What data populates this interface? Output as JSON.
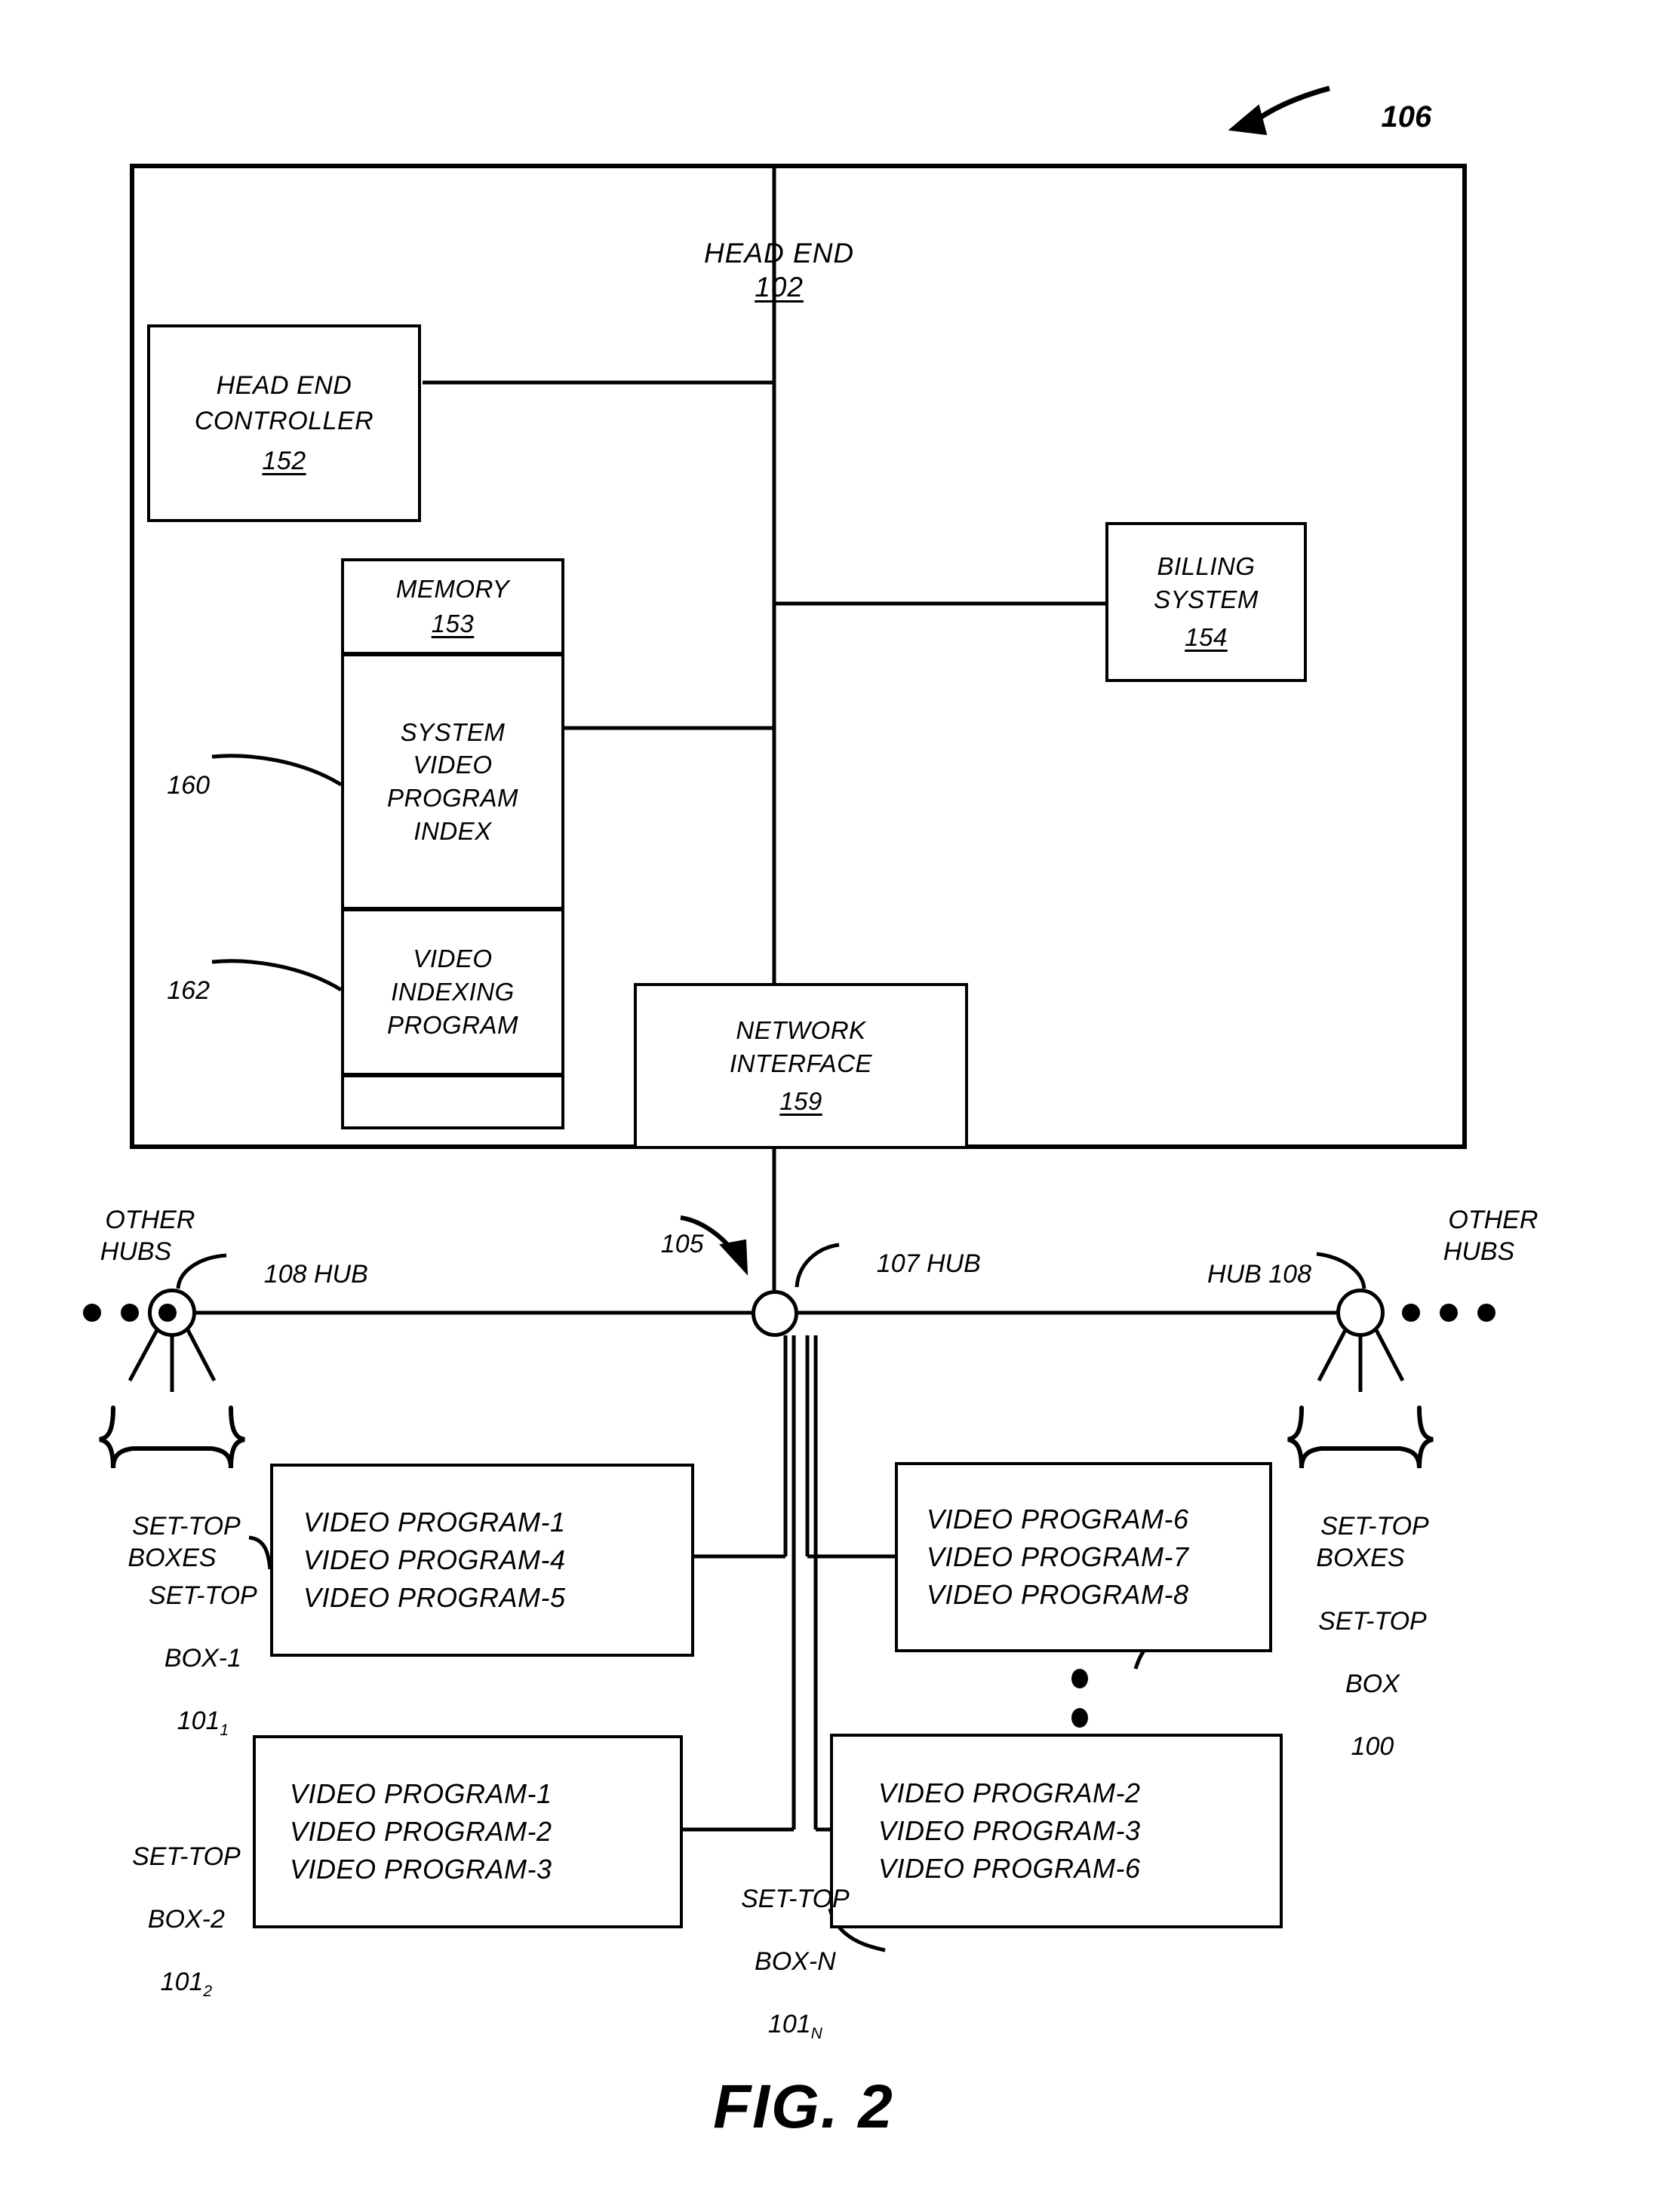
{
  "figure": {
    "caption": "FIG. 2",
    "system_ref": "106"
  },
  "head_end": {
    "title": "HEAD END",
    "title_ref": "102",
    "controller": {
      "line1": "HEAD END",
      "line2": "CONTROLLER",
      "ref": "152"
    },
    "memory": {
      "title": "MEMORY",
      "ref": "153",
      "sections": [
        {
          "ref": "160",
          "lines": [
            "SYSTEM",
            "VIDEO",
            "PROGRAM",
            "INDEX"
          ]
        },
        {
          "ref": "162",
          "lines": [
            "VIDEO",
            "INDEXING",
            "PROGRAM"
          ]
        },
        {
          "ref": "",
          "lines": []
        }
      ]
    },
    "billing": {
      "line1": "BILLING",
      "line2": "SYSTEM",
      "ref": "154"
    },
    "network_interface": {
      "line1": "NETWORK",
      "line2": "INTERFACE",
      "ref": "159"
    }
  },
  "network": {
    "bus_ref": "105",
    "hub_left": {
      "label": "108 HUB",
      "other_hubs": "OTHER\nHUBS",
      "set_top_boxes": "SET-TOP\nBOXES"
    },
    "hub_center": {
      "label": "107 HUB"
    },
    "hub_right": {
      "label": "HUB 108",
      "other_hubs": "OTHER\nHUBS",
      "set_top_boxes": "SET-TOP\nBOXES"
    }
  },
  "set_top_boxes": [
    {
      "caption_lines": [
        "SET-TOP",
        "BOX-1"
      ],
      "ref": "101",
      "ref_sub": "1",
      "programs": [
        "VIDEO PROGRAM-1",
        "VIDEO PROGRAM-4",
        "VIDEO PROGRAM-5"
      ]
    },
    {
      "caption_lines": [
        "SET-TOP",
        "BOX"
      ],
      "ref": "100",
      "ref_sub": "",
      "programs": [
        "VIDEO PROGRAM-6",
        "VIDEO PROGRAM-7",
        "VIDEO PROGRAM-8"
      ]
    },
    {
      "caption_lines": [
        "SET-TOP",
        "BOX-2"
      ],
      "ref": "101",
      "ref_sub": "2",
      "programs": [
        "VIDEO PROGRAM-1",
        "VIDEO PROGRAM-2",
        "VIDEO PROGRAM-3"
      ]
    },
    {
      "caption_lines": [
        "SET-TOP",
        "BOX-N"
      ],
      "ref": "101",
      "ref_sub": "N",
      "programs": [
        "VIDEO PROGRAM-2",
        "VIDEO PROGRAM-3",
        "VIDEO PROGRAM-6"
      ]
    }
  ],
  "colors": {
    "ink": "#000000",
    "paper": "#ffffff"
  }
}
